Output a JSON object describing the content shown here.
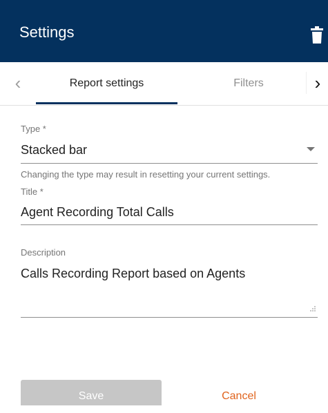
{
  "header": {
    "title": "Settings",
    "delete_icon": "trash-icon"
  },
  "tabs": {
    "prev_icon": "chevron-left-icon",
    "next_icon": "chevron-right-icon",
    "items": [
      {
        "label": "Report settings",
        "active": true
      },
      {
        "label": "Filters",
        "active": false
      }
    ]
  },
  "form": {
    "type": {
      "label": "Type *",
      "value": "Stacked bar",
      "helper": "Changing the type may result in resetting your current settings."
    },
    "title": {
      "label": "Title *",
      "value": "Agent Recording Total Calls"
    },
    "description": {
      "label": "Description",
      "value": "Calls Recording Report based on Agents"
    }
  },
  "actions": {
    "save_label": "Save",
    "save_enabled": false,
    "cancel_label": "Cancel"
  },
  "colors": {
    "header_bg": "#04315e",
    "accent": "#04315e",
    "cancel": "#e0631d",
    "disabled": "#c6c6c6"
  }
}
